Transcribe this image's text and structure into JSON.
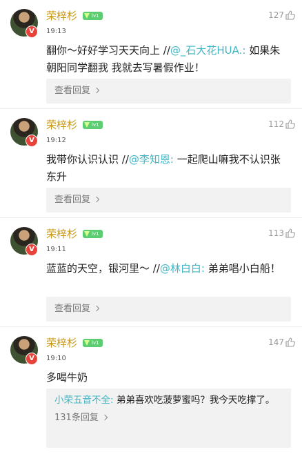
{
  "comments": [
    {
      "name": "荣梓杉",
      "level": "lv1",
      "time": "19:13",
      "likes": "127",
      "text_pre": "翻你～好好学习天天向上 //",
      "mention": "@_石大花HUA.:",
      "text_post": " 如果朱朝阳同学翻我 我就去写暑假作业！",
      "reply_link": "查看回复"
    },
    {
      "name": "荣梓杉",
      "level": "lv1",
      "time": "19:12",
      "likes": "112",
      "text_pre": "我带你认识认识 //",
      "mention": "@李知恩:",
      "text_post": " 一起爬山嘛我不认识张东升",
      "reply_link": "查看回复"
    },
    {
      "name": "荣梓杉",
      "level": "lv1",
      "time": "19:11",
      "likes": "113",
      "text_pre": "蓝蓝的天空，银河里～ //",
      "mention": "@林白白:",
      "text_post": " 弟弟唱小白船！",
      "reply_link": "查看回复"
    },
    {
      "name": "荣梓杉",
      "level": "lv1",
      "time": "19:10",
      "likes": "147",
      "text": "多喝牛奶",
      "sub_reply": {
        "name": "小荣五音不全:",
        "text": " 弟弟喜欢吃菠萝蜜吗？我今天吃撑了。",
        "count": "131条回复"
      }
    }
  ],
  "colors": {
    "name": "#c8960f",
    "mention": "#3fb6c6",
    "level_badge": "#5ccd71",
    "v_badge": "#e8433a"
  },
  "icons": {
    "like": "thumbs-up-icon",
    "verified": "v-badge-icon",
    "chevron": "chevron-right-icon"
  }
}
